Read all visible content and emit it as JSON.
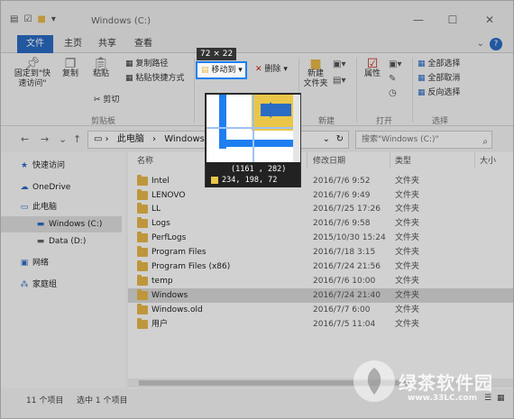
{
  "window": {
    "title": "Windows (C:)",
    "controls": [
      "—",
      "☐",
      "✕"
    ]
  },
  "tabs": [
    {
      "label": "文件",
      "active": true
    },
    {
      "label": "主页"
    },
    {
      "label": "共享"
    },
    {
      "label": "查看"
    }
  ],
  "ribbon": {
    "clipboard": {
      "pin_label": "固定到\"快\n速访问\"",
      "copy_label": "复制",
      "paste_label": "粘贴",
      "cut_label": "剪切",
      "copy_path_label": "复制路径",
      "paste_shortcut_label": "粘贴快捷方式",
      "group_label": "剪贴板"
    },
    "organize": {
      "move_to_label": "移动到",
      "delete_label": "删除"
    },
    "new": {
      "new_folder_label": "新建\n文件夹",
      "group_label": "新建"
    },
    "open": {
      "properties_label": "属性",
      "group_label": "打开"
    },
    "select": {
      "select_all_label": "全部选择",
      "select_none_label": "全部取消",
      "invert_label": "反向选择",
      "group_label": "选择"
    }
  },
  "address": {
    "crumbs": [
      "此电脑",
      "Windows (C"
    ],
    "search_placeholder": "搜索\"Windows (C:)\""
  },
  "nav_pane": [
    {
      "label": "快速访问",
      "icon": "star-icon"
    },
    {
      "label": "OneDrive",
      "icon": "cloud-icon"
    },
    {
      "label": "此电脑",
      "icon": "computer-icon"
    },
    {
      "label": "Windows (C:)",
      "icon": "drive-icon",
      "selected": true
    },
    {
      "label": "Data (D:)",
      "icon": "drive-icon"
    },
    {
      "label": "网络",
      "icon": "network-icon"
    },
    {
      "label": "家庭组",
      "icon": "homegroup-icon"
    }
  ],
  "columns": {
    "name": "名称",
    "date": "修改日期",
    "type": "类型",
    "size": "大小"
  },
  "files": [
    {
      "name": "Intel",
      "date": "2016/7/6 9:52",
      "type": "文件夹"
    },
    {
      "name": "LENOVO",
      "date": "2016/7/6 9:49",
      "type": "文件夹"
    },
    {
      "name": "LL",
      "date": "2016/7/25 17:26",
      "type": "文件夹"
    },
    {
      "name": "Logs",
      "date": "2016/7/6 9:58",
      "type": "文件夹"
    },
    {
      "name": "PerfLogs",
      "date": "2015/10/30 15:24",
      "type": "文件夹"
    },
    {
      "name": "Program Files",
      "date": "2016/7/18 3:15",
      "type": "文件夹"
    },
    {
      "name": "Program Files (x86)",
      "date": "2016/7/24 21:56",
      "type": "文件夹"
    },
    {
      "name": "temp",
      "date": "2016/7/6 10:00",
      "type": "文件夹"
    },
    {
      "name": "Windows",
      "date": "2016/7/24 21:40",
      "type": "文件夹",
      "selected": true
    },
    {
      "name": "Windows.old",
      "date": "2016/7/7 6:00",
      "type": "文件夹"
    },
    {
      "name": "用户",
      "date": "2016/7/5 11:04",
      "type": "文件夹"
    }
  ],
  "status": {
    "count": "11 个项目",
    "selected": "选中 1 个项目"
  },
  "capture": {
    "size": "72 × 22",
    "coords": "(1161 , 282)",
    "rgb": "234, 198,  72",
    "swatch_color": "#eac648"
  },
  "watermark": {
    "text": "绿茶软件园",
    "url": "www.33LC.com"
  },
  "colors": {
    "accent": "#2a6cc4",
    "folder": "#e8b94a",
    "capture_border": "#1e7ff0"
  }
}
